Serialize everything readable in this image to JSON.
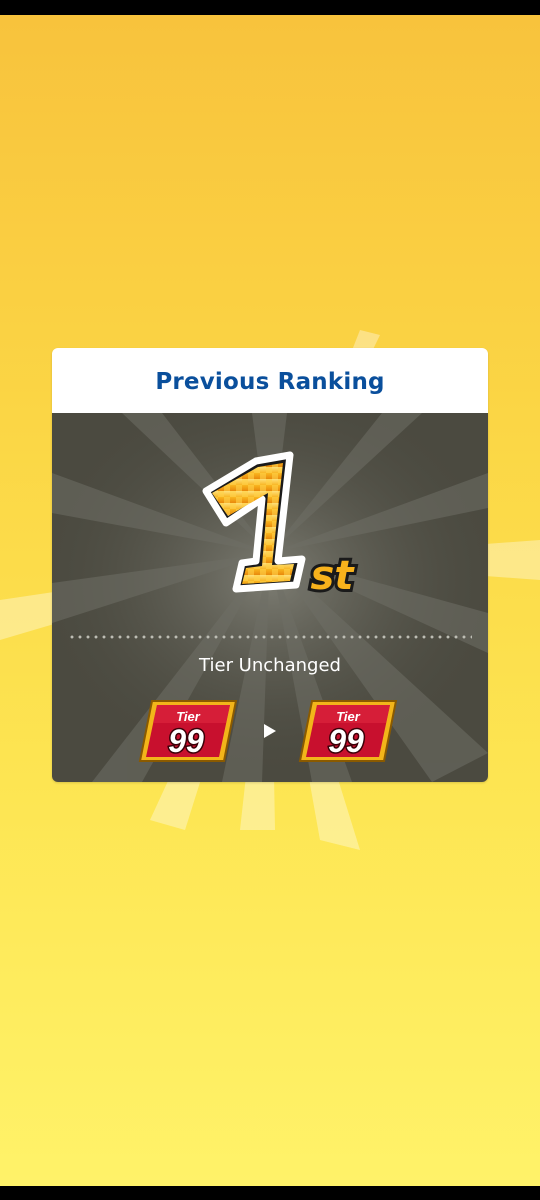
{
  "panel": {
    "title": "Previous Ranking",
    "rank": {
      "number": "1",
      "suffix": "st"
    },
    "tier_status": "Tier Unchanged",
    "old_tier": {
      "label": "Tier",
      "value": "99"
    },
    "new_tier": {
      "label": "Tier",
      "value": "99"
    }
  },
  "colors": {
    "title": "#0a4f9c",
    "background_top": "#f8c23c",
    "background_bottom": "#fff36a",
    "panel_body": "#4b4a40",
    "badge_red": "#c8102e",
    "badge_gold": "#f2b51a"
  },
  "icons": {
    "arrow": "triangle-right-icon"
  }
}
